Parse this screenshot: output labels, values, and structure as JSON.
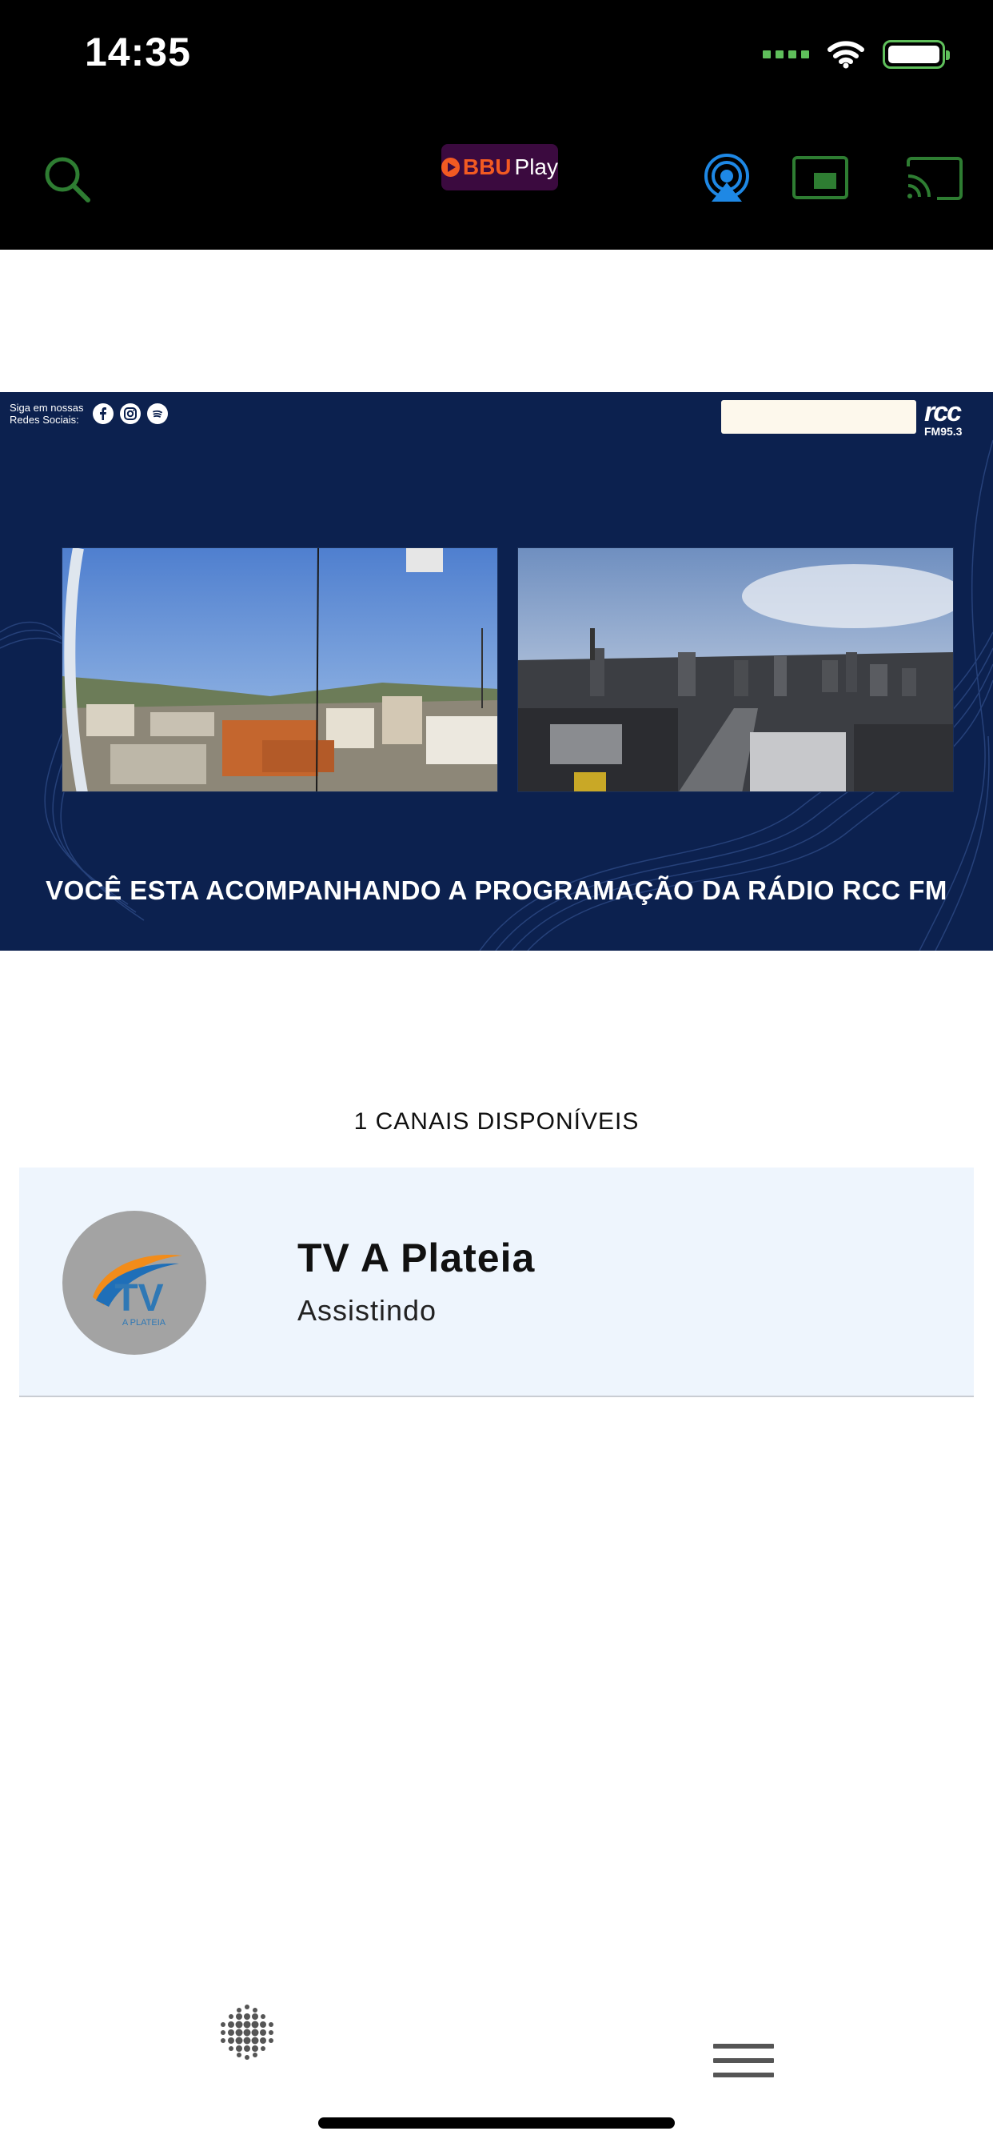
{
  "status_bar": {
    "time": "14:35"
  },
  "header": {
    "logo_brand": "BBU",
    "logo_suffix": "Play",
    "accent_color": "#2e7d32",
    "airplay_color": "#1e88e5"
  },
  "banner": {
    "follow_text": "Siga em nossas Redes Sociais:",
    "social_icons": [
      "facebook-icon",
      "instagram-icon",
      "spotify-icon"
    ],
    "station_logo_main": "rcc",
    "station_logo_sub": "FM95.3",
    "caption": "VOCÊ ESTA ACOMPANHANDO A PROGRAMAÇÃO DA RÁDIO RCC FM",
    "background_color": "#0c214f"
  },
  "channels": {
    "title": "1 CANAIS DISPONÍVEIS",
    "items": [
      {
        "name": "TV A Plateia",
        "status": "Assistindo",
        "avatar_text": "TV",
        "avatar_subtext": "A PLATEIA"
      }
    ]
  },
  "bottom_bar": {
    "icons": [
      "dot-grid-icon",
      "hamburger-menu-icon"
    ]
  }
}
